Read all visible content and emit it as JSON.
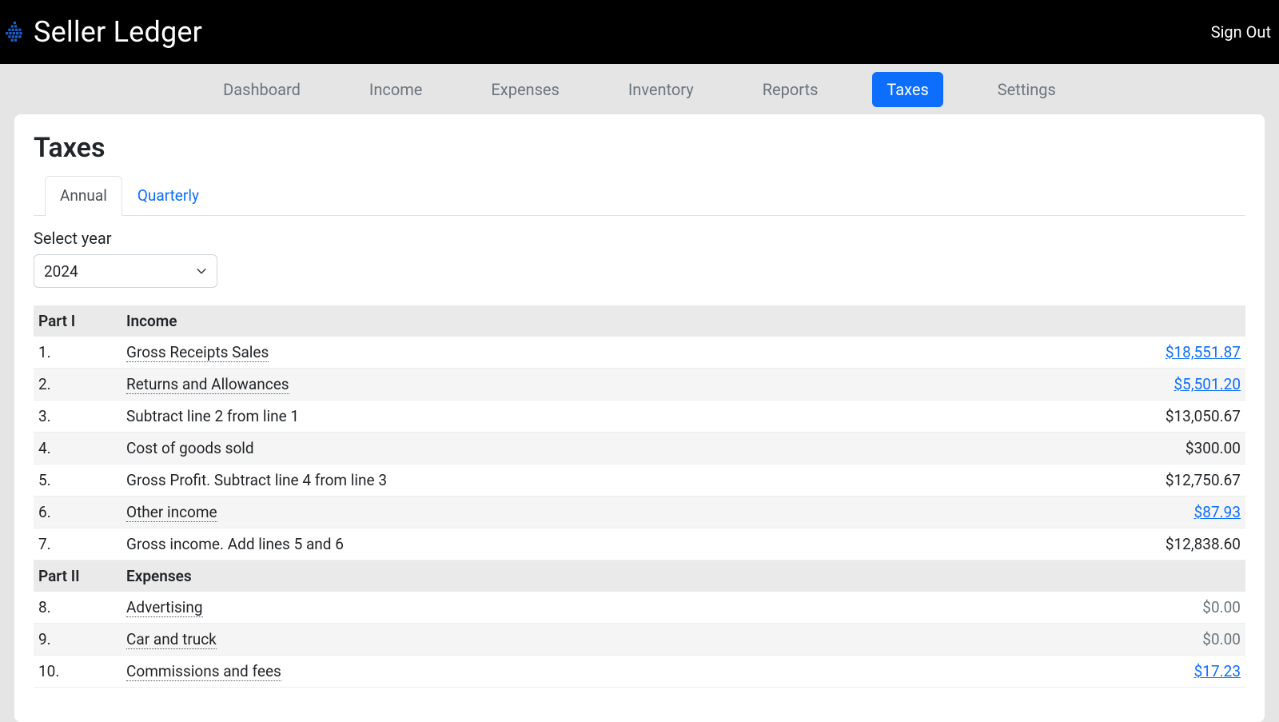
{
  "brand": {
    "name": "Seller Ledger"
  },
  "header": {
    "sign_out": "Sign Out"
  },
  "nav": {
    "items": [
      {
        "label": "Dashboard",
        "active": false
      },
      {
        "label": "Income",
        "active": false
      },
      {
        "label": "Expenses",
        "active": false
      },
      {
        "label": "Inventory",
        "active": false
      },
      {
        "label": "Reports",
        "active": false
      },
      {
        "label": "Taxes",
        "active": true
      },
      {
        "label": "Settings",
        "active": false
      }
    ]
  },
  "page": {
    "title": "Taxes"
  },
  "tabs": {
    "items": [
      {
        "label": "Annual",
        "active": true
      },
      {
        "label": "Quarterly",
        "active": false
      }
    ]
  },
  "year_selector": {
    "label": "Select year",
    "value": "2024"
  },
  "sections": [
    {
      "part": "Part I",
      "title": "Income"
    },
    {
      "part": "Part II",
      "title": "Expenses"
    }
  ],
  "rows": [
    {
      "section": 0,
      "num": "1.",
      "label": "Gross Receipts Sales",
      "value": "$18,551.87",
      "link": true,
      "dotted": true,
      "muted": false
    },
    {
      "section": 0,
      "num": "2.",
      "label": "Returns and Allowances",
      "value": "$5,501.20",
      "link": true,
      "dotted": true,
      "muted": false
    },
    {
      "section": 0,
      "num": "3.",
      "label": "Subtract line 2 from line 1",
      "value": "$13,050.67",
      "link": false,
      "dotted": false,
      "muted": false
    },
    {
      "section": 0,
      "num": "4.",
      "label": "Cost of goods sold",
      "value": "$300.00",
      "link": false,
      "dotted": false,
      "muted": false
    },
    {
      "section": 0,
      "num": "5.",
      "label": "Gross Profit. Subtract line 4 from line 3",
      "value": "$12,750.67",
      "link": false,
      "dotted": false,
      "muted": false
    },
    {
      "section": 0,
      "num": "6.",
      "label": "Other income",
      "value": "$87.93",
      "link": true,
      "dotted": true,
      "muted": false
    },
    {
      "section": 0,
      "num": "7.",
      "label": "Gross income. Add lines 5 and 6",
      "value": "$12,838.60",
      "link": false,
      "dotted": false,
      "muted": false
    },
    {
      "section": 1,
      "num": "8.",
      "label": "Advertising",
      "value": "$0.00",
      "link": false,
      "dotted": true,
      "muted": true
    },
    {
      "section": 1,
      "num": "9.",
      "label": "Car and truck",
      "value": "$0.00",
      "link": false,
      "dotted": true,
      "muted": true
    },
    {
      "section": 1,
      "num": "10.",
      "label": "Commissions and fees",
      "value": "$17.23",
      "link": true,
      "dotted": true,
      "muted": false
    }
  ]
}
